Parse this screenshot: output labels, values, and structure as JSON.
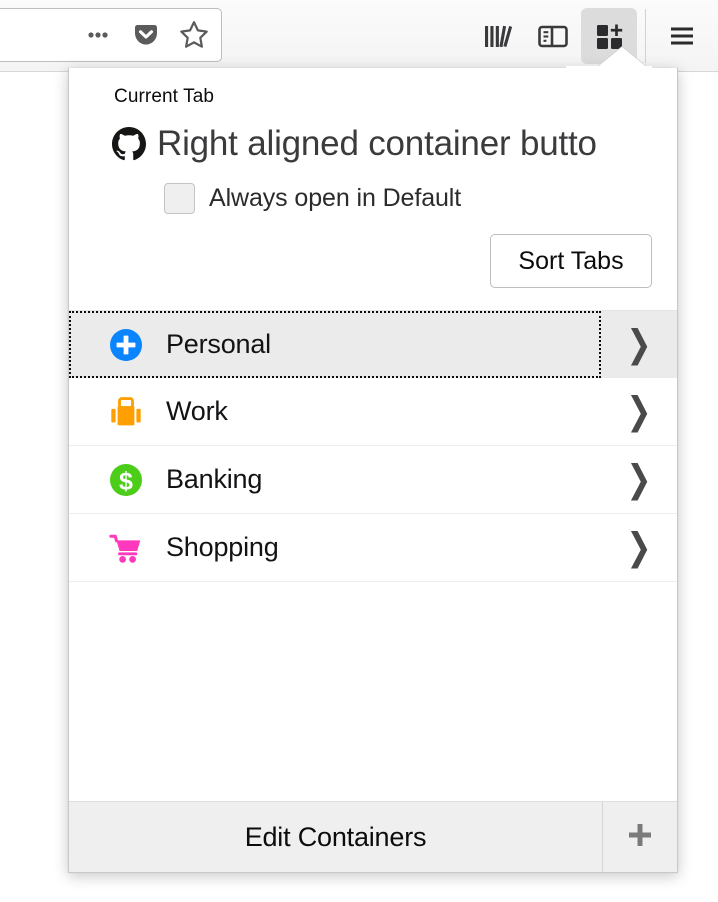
{
  "browser_toolbar": {
    "urlbar_icons": [
      {
        "name": "page-actions-icon",
        "glyph": "…"
      },
      {
        "name": "pocket-icon",
        "glyph": "pocket"
      },
      {
        "name": "bookmark-star-icon",
        "glyph": "star"
      }
    ],
    "buttons": [
      {
        "name": "library-icon",
        "label": "Library",
        "active": false
      },
      {
        "name": "sidebar-icon",
        "label": "Sidebars",
        "active": false
      },
      {
        "name": "containers-icon",
        "label": "Containers",
        "active": true
      },
      {
        "name": "hamburger-menu-icon",
        "label": "Open menu",
        "active": false
      }
    ]
  },
  "popup": {
    "current_tab_label": "Current Tab",
    "tab": {
      "favicon": "github-octocat-icon",
      "title": "Right aligned container butto"
    },
    "always_open": {
      "label": "Always open in Default",
      "checked": false
    },
    "sort_tabs_label": "Sort Tabs",
    "containers": [
      {
        "name": "Personal",
        "icon": "fingerprint-plus-icon",
        "color": "#0a84ff",
        "selected": true,
        "chevron": "❯"
      },
      {
        "name": "Work",
        "icon": "briefcase-icon",
        "color": "#ffa000",
        "selected": false,
        "chevron": "❯"
      },
      {
        "name": "Banking",
        "icon": "dollar-circle-icon",
        "color": "#4ccd19",
        "selected": false,
        "chevron": "❯"
      },
      {
        "name": "Shopping",
        "icon": "shopping-cart-icon",
        "color": "#ff39bd",
        "selected": false,
        "chevron": "❯"
      }
    ],
    "footer": {
      "edit_label": "Edit Containers",
      "add_icon": "plus-icon"
    }
  },
  "colors": {
    "accent_blue": "#0a84ff",
    "work_orange": "#ffa000",
    "banking_green": "#4ccd19",
    "shopping_pink": "#ff39bd",
    "selected_row_bg": "#ebebeb",
    "footer_bg": "#efefef"
  }
}
